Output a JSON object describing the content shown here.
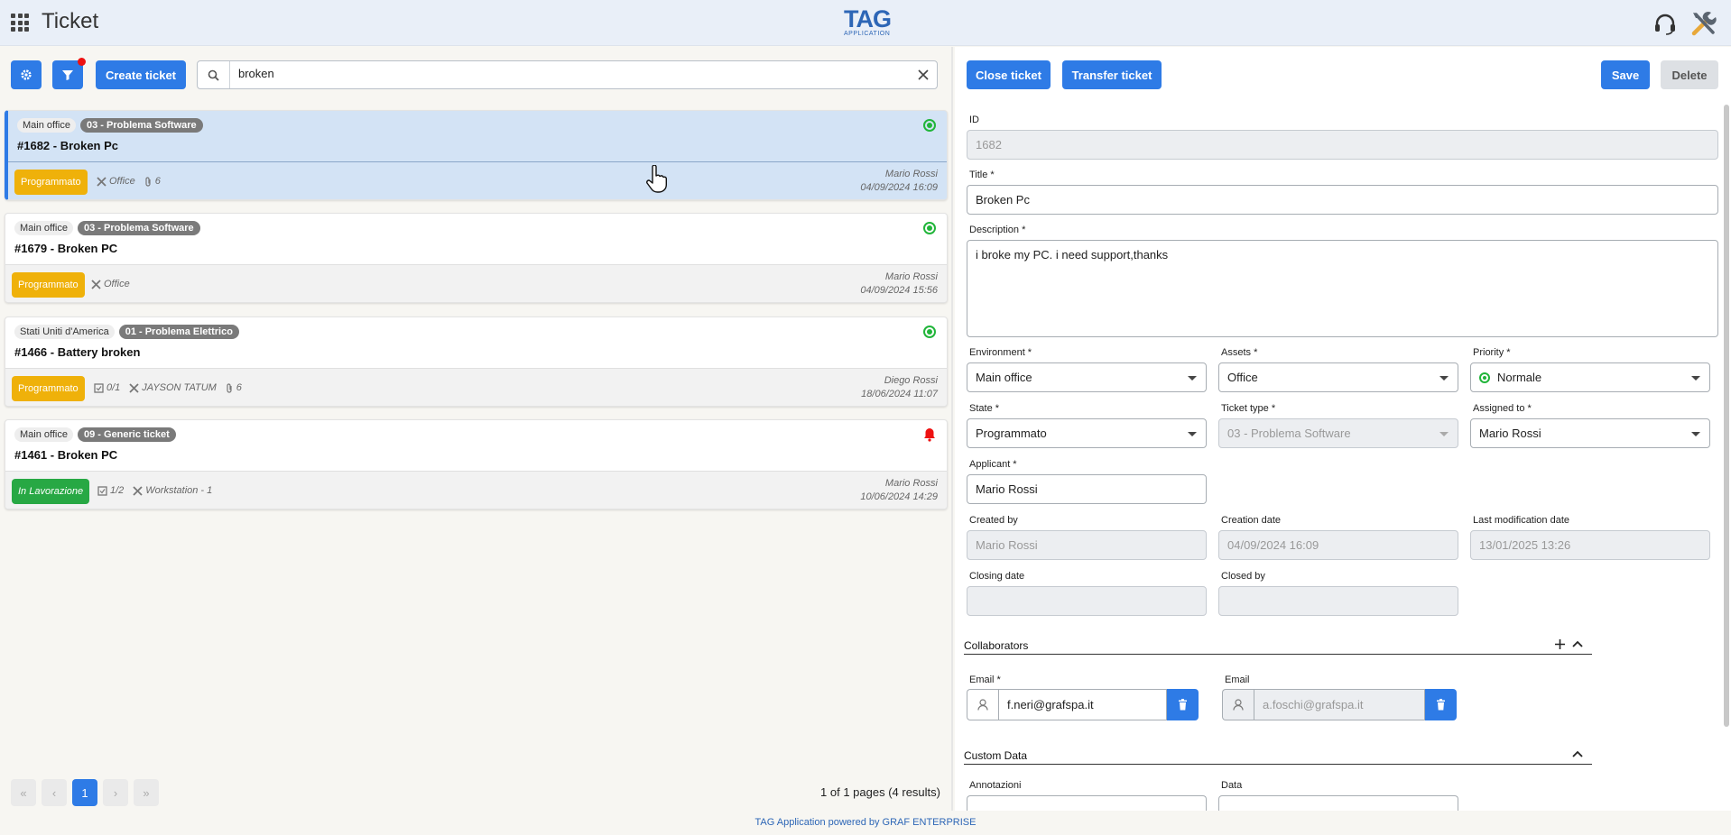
{
  "header": {
    "title": "Ticket",
    "logo_big": "TAG",
    "logo_small": "APPLICATION"
  },
  "toolbar": {
    "create_label": "Create ticket",
    "search_value": "broken"
  },
  "tickets": [
    {
      "env": "Main office",
      "type": "03 - Problema Software",
      "title": "#1682 - Broken Pc",
      "state": "Programmato",
      "asset": "Office",
      "attachments": "6",
      "user": "Mario Rossi",
      "date": "04/09/2024 16:09"
    },
    {
      "env": "Main office",
      "type": "03 - Problema Software",
      "title": "#1679 - Broken PC",
      "state": "Programmato",
      "asset": "Office",
      "user": "Mario Rossi",
      "date": "04/09/2024 15:56"
    },
    {
      "env": "Stati Uniti d'America",
      "type": "01 - Problema Elettrico",
      "title": "#1466 - Battery broken",
      "state": "Programmato",
      "checklist": "0/1",
      "asset": "JAYSON TATUM",
      "attachments": "6",
      "user": "Diego Rossi",
      "date": "18/06/2024 11:07"
    },
    {
      "env": "Main office",
      "type": "09 - Generic ticket",
      "title": "#1461 - Broken PC",
      "state": "In Lavorazione",
      "checklist": "1/2",
      "asset": "Workstation - 1",
      "user": "Mario Rossi",
      "date": "10/06/2024 14:29"
    }
  ],
  "pager": {
    "current": "1",
    "info": "1 of 1 pages (4 results)"
  },
  "detail": {
    "close_label": "Close ticket",
    "transfer_label": "Transfer ticket",
    "save_label": "Save",
    "delete_label": "Delete",
    "id_label": "ID",
    "id_value": "1682",
    "title_label": "Title *",
    "title_value": "Broken Pc",
    "description_label": "Description *",
    "description_value": "i broke my PC. i need support,thanks",
    "environment_label": "Environment *",
    "environment_value": "Main office",
    "assets_label": "Assets *",
    "assets_value": "Office",
    "priority_label": "Priority *",
    "priority_value": "Normale",
    "state_label": "State *",
    "state_value": "Programmato",
    "ticket_type_label": "Ticket type *",
    "ticket_type_value": "03 - Problema Software",
    "assigned_label": "Assigned to *",
    "assigned_value": "Mario Rossi",
    "applicant_label": "Applicant *",
    "applicant_value": "Mario Rossi",
    "created_by_label": "Created by",
    "created_by_value": "Mario Rossi",
    "creation_date_label": "Creation date",
    "creation_date_value": "04/09/2024 16:09",
    "last_mod_label": "Last modification date",
    "last_mod_value": "13/01/2025 13:26",
    "closing_date_label": "Closing date",
    "closed_by_label": "Closed by",
    "collaborators_title": "Collaborators",
    "email1_label": "Email *",
    "email1_value": "f.neri@grafspa.it",
    "email2_label": "Email",
    "email2_value": "a.foschi@grafspa.it",
    "custom_data_title": "Custom Data",
    "annotazioni_label": "Annotazioni",
    "data_label": "Data"
  },
  "footer": {
    "text": "TAG Application powered by GRAF ENTERPRISE"
  },
  "colors": {
    "accent": "#2e7be6",
    "programmato": "#efb10a",
    "in_lavorazione": "#27a844",
    "status_ok": "#21b53a",
    "alert": "#e11"
  }
}
